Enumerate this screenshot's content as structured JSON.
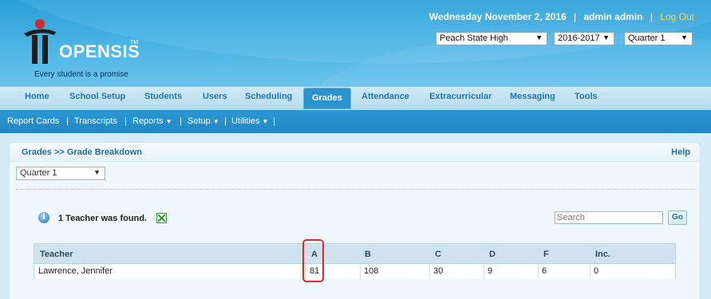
{
  "header": {
    "date": "Wednesday November 2, 2016",
    "user": "admin admin",
    "logout": "Log Out",
    "logo_open": "OPEN",
    "logo_sis": "SIS",
    "logo_tm": "TM",
    "tagline": "Every student is a promise",
    "school": "Peach State High",
    "year": "2016-2017",
    "quarter": "Quarter 1"
  },
  "mainnav": {
    "items": [
      "Home",
      "School Setup",
      "Students",
      "Users",
      "Scheduling",
      "Grades",
      "Attendance",
      "Extracurricular",
      "Messaging",
      "Tools"
    ],
    "active": "Grades"
  },
  "subnav": {
    "items": [
      "Report Cards",
      "Transcripts",
      "Reports",
      "Setup",
      "Utilities"
    ]
  },
  "page": {
    "breadcrumb": "Grades >> Grade Breakdown",
    "help": "Help",
    "period_select": "Quarter 1",
    "found_text": "1 Teacher was found.",
    "search_placeholder": "Search",
    "go_label": "Go"
  },
  "table": {
    "headers": [
      "Teacher",
      "A",
      "B",
      "C",
      "D",
      "F",
      "Inc."
    ],
    "rows": [
      [
        "Lawrence, Jennifer",
        "81",
        "108",
        "30",
        "9",
        "6",
        "0"
      ]
    ]
  },
  "colors": {
    "header_blue": "#2a9fd8",
    "nav_text": "#1f76ad",
    "highlight": "#e02828"
  }
}
